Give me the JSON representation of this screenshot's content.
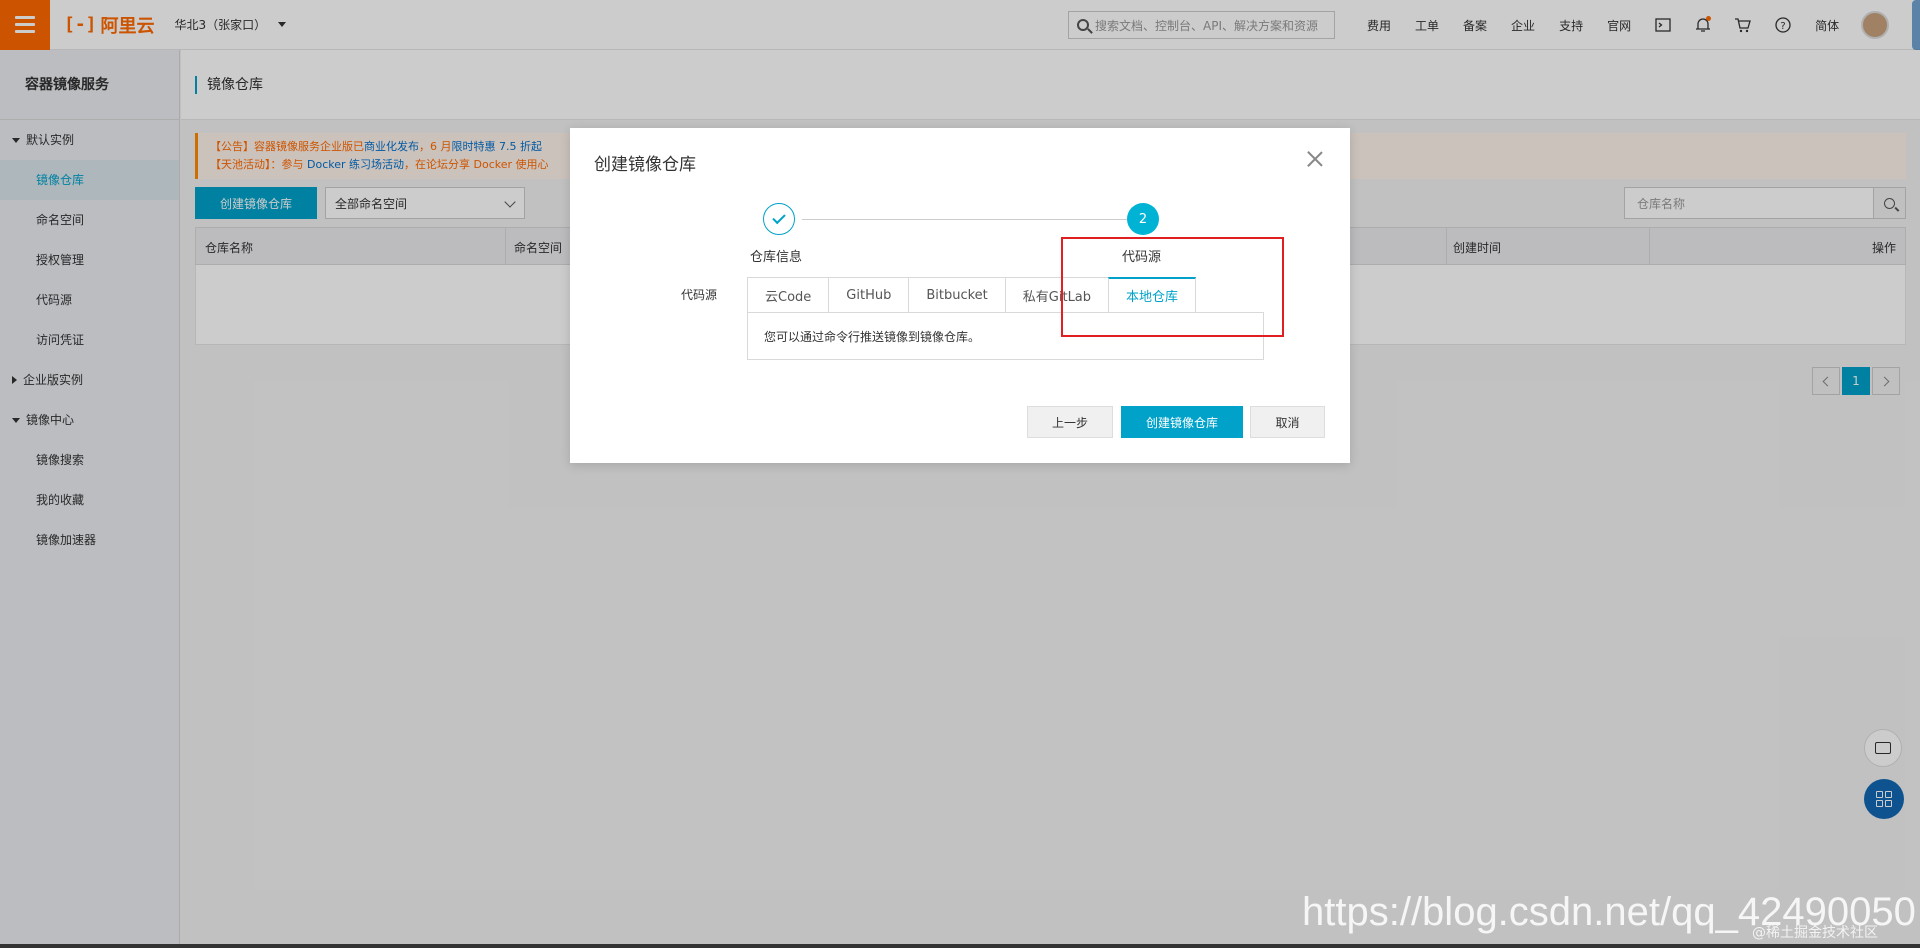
{
  "topbar": {
    "logo_text": "阿里云",
    "region": "华北3（张家口）",
    "search_placeholder": "搜索文档、控制台、API、解决方案和资源",
    "nav": [
      "费用",
      "工单",
      "备案",
      "企业",
      "支持",
      "官网"
    ],
    "lang": "简体"
  },
  "sidebar": {
    "title": "容器镜像服务",
    "group_default": "默认实例",
    "items_default": [
      "镜像仓库",
      "命名空间",
      "授权管理",
      "代码源",
      "访问凭证"
    ],
    "group_enterprise": "企业版实例",
    "group_center": "镜像中心",
    "items_center": [
      "镜像搜索",
      "我的收藏",
      "镜像加速器"
    ]
  },
  "main": {
    "page_title": "镜像仓库",
    "notice_line1_a": "【公告】容器镜像服务企业版已",
    "notice_line1_b": "商业化发布",
    "notice_line1_c": "，6 月",
    "notice_line1_d": "限时特惠 7.5 折起",
    "notice_line2_a": "【天池活动】：参与 ",
    "notice_line2_b": "Docker 练习场活动",
    "notice_line2_c": "，在论坛分享 Docker 使用心",
    "create_button": "创建镜像仓库",
    "namespace_select": "全部命名空间",
    "repo_search_placeholder": "仓库名称",
    "columns": [
      "仓库名称",
      "命名空间",
      "创建时间",
      "操作"
    ],
    "page_current": "1"
  },
  "modal": {
    "title": "创建镜像仓库",
    "step1_label": "仓库信息",
    "step2_number": "2",
    "step2_label": "代码源",
    "source_label": "代码源",
    "tabs": [
      "云Code",
      "GitHub",
      "Bitbucket",
      "私有GitLab",
      "本地仓库"
    ],
    "active_tab": "本地仓库",
    "panel_text": "您可以通过命令行推送镜像到镜像仓库。",
    "btn_prev": "上一步",
    "btn_create": "创建镜像仓库",
    "btn_cancel": "取消"
  },
  "watermark": {
    "url": "https://blog.csdn.net/qq_42490050",
    "small": "@稀土掘金技术社区"
  },
  "colors": {
    "brand_orange": "#ff6a00",
    "primary": "#00a2ca",
    "annotation_red": "#e02020"
  }
}
